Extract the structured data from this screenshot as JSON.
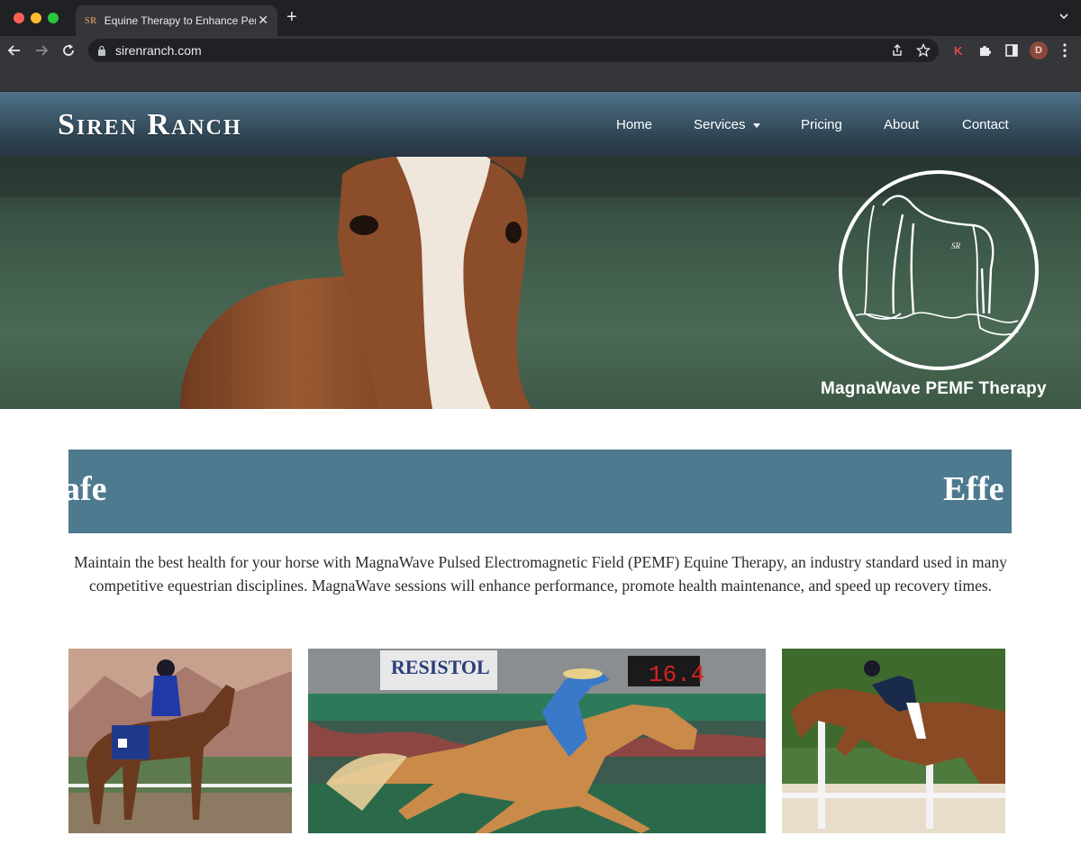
{
  "browser": {
    "tab_title": "Equine Therapy to Enhance Performance",
    "tab_favicon": "SR",
    "url": "sirenranch.com",
    "profile_initial": "D",
    "extension_initial": "K"
  },
  "site": {
    "logo": "Siren Ranch",
    "nav": {
      "home": "Home",
      "services": "Services",
      "pricing": "Pricing",
      "about": "About",
      "contact": "Contact"
    }
  },
  "hero": {
    "caption": "MagnaWave PEMF Therapy",
    "badge_monogram": "SR"
  },
  "banner": {
    "left_word": "afe",
    "right_word": "Effe"
  },
  "intro": {
    "text": "Maintain the best health for your horse with MagnaWave Pulsed Electromagnetic Field (PEMF) Equine Therapy, an industry standard used in many competitive equestrian disciplines. MagnaWave sessions will enhance performance, promote health maintenance, and speed up recovery times."
  },
  "gallery": {
    "signage_resistol": "RESISTOL",
    "scoreboard": "16.4"
  },
  "colors": {
    "header_top": "#4e7287",
    "header_bottom": "#263642",
    "banner": "#4e7a8f",
    "text": "#2b2b2b"
  }
}
